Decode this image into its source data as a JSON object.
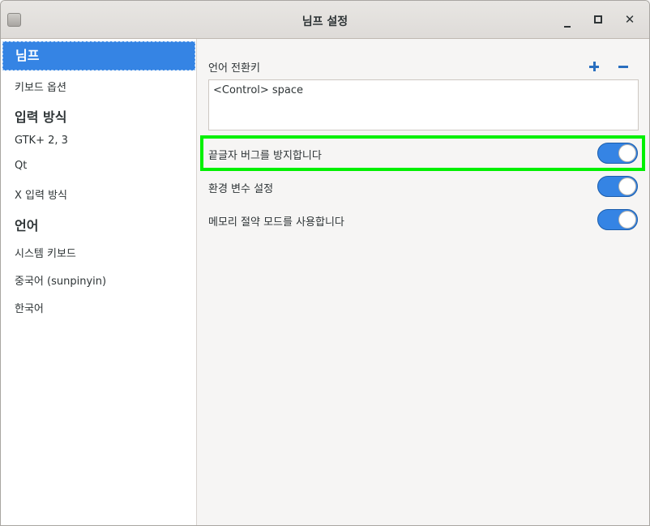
{
  "window": {
    "title": "님프 설정",
    "minimize_icon": "minimize-icon",
    "maximize_icon": "maximize-icon",
    "close_icon": "close-icon",
    "close_glyph": "✕"
  },
  "sidebar": {
    "items": [
      {
        "label": "님프",
        "kind": "selected"
      },
      {
        "label": "키보드 옵션",
        "kind": "normal"
      },
      {
        "label": "입력 방식",
        "kind": "header"
      },
      {
        "label": "GTK+ 2, 3",
        "kind": "normal"
      },
      {
        "label": "Qt",
        "kind": "normal"
      },
      {
        "label": "X 입력 방식",
        "kind": "normal"
      },
      {
        "label": "언어",
        "kind": "header"
      },
      {
        "label": "시스템 키보드",
        "kind": "normal"
      },
      {
        "label": "중국어 (sunpinyin)",
        "kind": "normal"
      },
      {
        "label": "한국어",
        "kind": "normal"
      }
    ]
  },
  "content": {
    "hotkey_section_label": "언어 전환키",
    "hotkeys": [
      "<Control> space"
    ],
    "options": [
      {
        "label": "끝글자 버그를 방지합니다",
        "enabled": true
      },
      {
        "label": "환경 변수 설정",
        "enabled": true
      },
      {
        "label": "메모리 절약 모드를 사용합니다",
        "enabled": true
      }
    ]
  },
  "colors": {
    "accent": "#3584e4",
    "highlight": "#00f000"
  }
}
